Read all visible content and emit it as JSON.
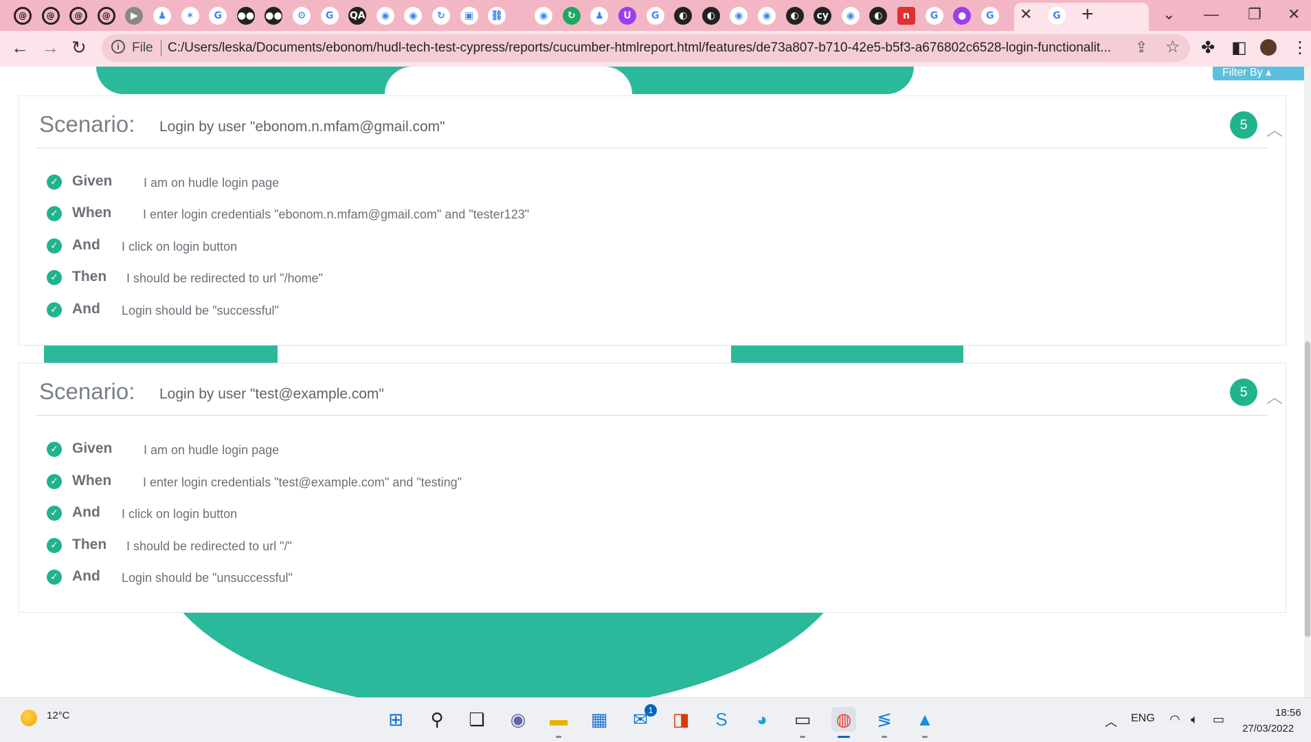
{
  "browser": {
    "tabs": [
      {
        "icon": "at-icon",
        "glyph": "@"
      },
      {
        "icon": "at-icon",
        "glyph": "@"
      },
      {
        "icon": "at-icon",
        "glyph": "@"
      },
      {
        "icon": "at-icon",
        "glyph": "@"
      },
      {
        "icon": "play-icon",
        "glyph": "▶"
      },
      {
        "icon": "figure-icon",
        "glyph": "♟"
      },
      {
        "icon": "crab-icon",
        "glyph": "✶"
      },
      {
        "icon": "google-icon",
        "glyph": "G"
      },
      {
        "icon": "medium-icon",
        "glyph": "●●"
      },
      {
        "icon": "medium-icon",
        "glyph": "●●"
      },
      {
        "icon": "gear-icon",
        "glyph": "⚙"
      },
      {
        "icon": "google-icon",
        "glyph": "G"
      },
      {
        "icon": "qa-icon",
        "glyph": "QA"
      },
      {
        "icon": "github-icon",
        "glyph": "◉"
      },
      {
        "icon": "github-icon",
        "glyph": "◉"
      },
      {
        "icon": "refresh-icon",
        "glyph": "↻"
      },
      {
        "icon": "chip-icon",
        "glyph": "▣"
      },
      {
        "icon": "link-icon",
        "glyph": "⛓"
      },
      {
        "icon": "github-icon",
        "glyph": "◉"
      },
      {
        "icon": "green-refresh-icon",
        "glyph": "↻"
      },
      {
        "icon": "figure-icon",
        "glyph": "♟"
      },
      {
        "icon": "purple-u-icon",
        "glyph": "U"
      },
      {
        "icon": "google-icon",
        "glyph": "G"
      },
      {
        "icon": "cypress-icon",
        "glyph": "◐"
      },
      {
        "icon": "cypress-icon",
        "glyph": "◐"
      },
      {
        "icon": "github-icon",
        "glyph": "◉"
      },
      {
        "icon": "github-icon",
        "glyph": "◉"
      },
      {
        "icon": "cypress-icon",
        "glyph": "◐"
      },
      {
        "icon": "cy-icon",
        "glyph": "cy"
      },
      {
        "icon": "github-icon",
        "glyph": "◉"
      },
      {
        "icon": "cypress-icon",
        "glyph": "◐"
      },
      {
        "icon": "red-n-icon",
        "glyph": "n"
      },
      {
        "icon": "google-icon",
        "glyph": "G"
      },
      {
        "icon": "purple-circle-icon",
        "glyph": "●"
      },
      {
        "icon": "google-icon",
        "glyph": "G"
      }
    ],
    "active_tab_icon": "google-icon",
    "url_scheme": "File",
    "url": "C:/Users/leska/Documents/ebonom/hudl-tech-test-cypress/reports/cucumber-htmlreport.html/features/de73a807-b710-42e5-b5f3-a676802c6528-login-functionalit..."
  },
  "report": {
    "filter_label": "Filter By ▴",
    "scenarios": [
      {
        "keyword": "Scenario:",
        "name": "Login by user \"ebonom.n.mfam@gmail.com\"",
        "step_count": "5",
        "steps": [
          {
            "keyword": "Given",
            "text": "I am on hudle login page",
            "status": "passed"
          },
          {
            "keyword": "When",
            "text": "I enter login credentials \"ebonom.n.mfam@gmail.com\" and \"tester123\"",
            "status": "passed"
          },
          {
            "keyword": "And",
            "text": "I click on login button",
            "status": "passed"
          },
          {
            "keyword": "Then",
            "text": "I should be redirected to url \"/home\"",
            "status": "passed"
          },
          {
            "keyword": "And",
            "text": "Login should be \"successful\"",
            "status": "passed"
          }
        ]
      },
      {
        "keyword": "Scenario:",
        "name": "Login by user \"test@example.com\"",
        "step_count": "5",
        "steps": [
          {
            "keyword": "Given",
            "text": "I am on hudle login page",
            "status": "passed"
          },
          {
            "keyword": "When",
            "text": "I enter login credentials \"test@example.com\" and \"testing\"",
            "status": "passed"
          },
          {
            "keyword": "And",
            "text": "I click on login button",
            "status": "passed"
          },
          {
            "keyword": "Then",
            "text": "I should be redirected to url \"/\"",
            "status": "passed"
          },
          {
            "keyword": "And",
            "text": "Login should be \"unsuccessful\"",
            "status": "passed"
          }
        ]
      }
    ]
  },
  "taskbar": {
    "temperature": "12°C",
    "mail_badge": "1",
    "language": "ENG",
    "time": "18:56",
    "date": "27/03/2022"
  },
  "colors": {
    "accent": "#2ab99a",
    "badge": "#1fb48d",
    "filter_button": "#5bc0de",
    "tabstrip": "#f3b6c4",
    "toolbar": "#fde3ea"
  }
}
